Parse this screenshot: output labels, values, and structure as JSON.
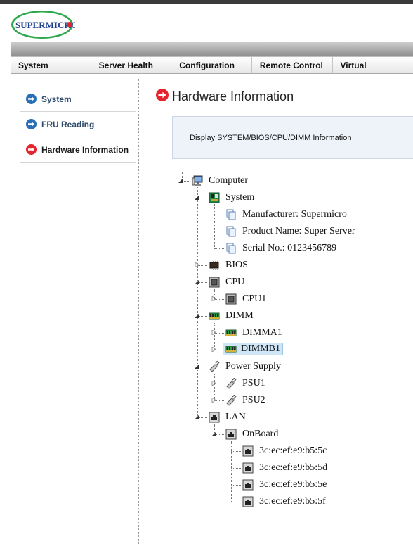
{
  "brand": {
    "logo_text": "SUPERMICRO"
  },
  "nav": {
    "tabs": [
      "System",
      "Server Health",
      "Configuration",
      "Remote Control",
      "Virtual"
    ]
  },
  "sidebar": {
    "items": [
      {
        "label": "System",
        "active": false
      },
      {
        "label": "FRU Reading",
        "active": false
      },
      {
        "label": "Hardware Information",
        "active": true
      }
    ]
  },
  "page": {
    "title": "Hardware Information",
    "description": "Display SYSTEM/BIOS/CPU/DIMM Information"
  },
  "tree": {
    "root": "Computer",
    "system": {
      "label": "System",
      "manufacturer": "Manufacturer: Supermicro",
      "product": "Product Name: Super Server",
      "serial": "Serial No.: 0123456789"
    },
    "bios": "BIOS",
    "cpu": {
      "label": "CPU",
      "items": [
        "CPU1"
      ]
    },
    "dimm": {
      "label": "DIMM",
      "items": [
        "DIMMA1",
        "DIMMB1"
      ],
      "selected": "DIMMB1"
    },
    "psu": {
      "label": "Power Supply",
      "items": [
        "PSU1",
        "PSU2"
      ]
    },
    "lan": {
      "label": "LAN",
      "onboard": "OnBoard",
      "macs": [
        "3c:ec:ef:e9:b5:5c",
        "3c:ec:ef:e9:b5:5d",
        "3c:ec:ef:e9:b5:5e",
        "3c:ec:ef:e9:b5:5f"
      ]
    }
  },
  "colors": {
    "accent_red": "#e5242b",
    "accent_blue": "#2a6fb5",
    "logo_green": "#3aa655"
  }
}
